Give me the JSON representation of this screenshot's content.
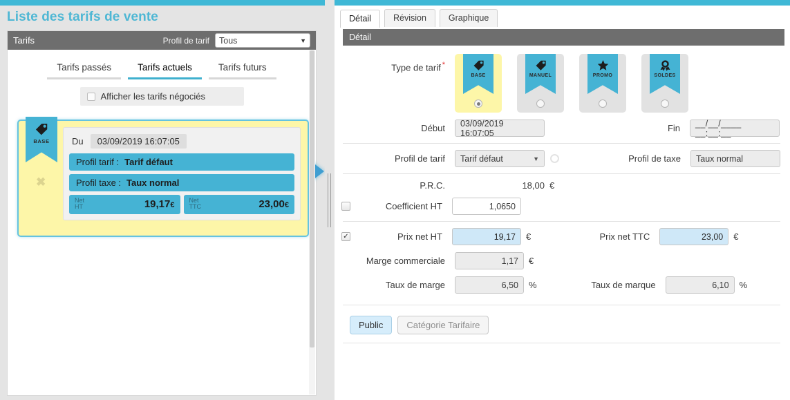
{
  "page": {
    "title": "Liste des tarifs de vente"
  },
  "left": {
    "bar": {
      "title": "Tarifs",
      "profile_label": "Profil de tarif",
      "profile_value": "Tous"
    },
    "tabs": [
      {
        "label": "Tarifs passés",
        "active": false
      },
      {
        "label": "Tarifs actuels",
        "active": true
      },
      {
        "label": "Tarifs futurs",
        "active": false
      }
    ],
    "negotiated": {
      "label": "Afficher les tarifs négociés",
      "checked": false
    },
    "card": {
      "ribbon_label": "BASE",
      "close_label": "✖",
      "du_label": "Du",
      "du_value": "03/09/2019 16:07:05",
      "profil_tarif_label": "Profil tarif :",
      "profil_tarif_value": "Tarif défaut",
      "profil_taxe_label": "Profil taxe :",
      "profil_taxe_value": "Taux normal",
      "net_ht_label_1": "Net",
      "net_ht_label_2": "HT",
      "net_ht_value": "19,17",
      "net_ht_currency": "€",
      "net_ttc_label_1": "Net",
      "net_ttc_label_2": "TTC",
      "net_ttc_value": "23,00",
      "net_ttc_currency": "€"
    }
  },
  "right": {
    "tabs": [
      {
        "label": "Détail",
        "active": true
      },
      {
        "label": "Révision",
        "active": false
      },
      {
        "label": "Graphique",
        "active": false
      }
    ],
    "section_title": "Détail",
    "type_de_tarif": {
      "label": "Type de tarif",
      "required_marker": "*",
      "options": [
        {
          "label": "BASE",
          "icon": "price-tag-icon",
          "selected": true
        },
        {
          "label": "MANUEL",
          "icon": "price-tag-icon",
          "selected": false
        },
        {
          "label": "PROMO",
          "icon": "star-icon",
          "selected": false
        },
        {
          "label": "SOLDES",
          "icon": "rosette-icon",
          "selected": false
        }
      ]
    },
    "fields": {
      "debut_label": "Début",
      "debut_value": "03/09/2019 16:07:05",
      "fin_label": "Fin",
      "fin_value": "__/__/____ __:__:__",
      "profil_tarif_label": "Profil de tarif",
      "profil_tarif_value": "Tarif défaut",
      "profil_taxe_label": "Profil de taxe",
      "profil_taxe_value": "Taux normal",
      "prc_label": "P.R.C.",
      "prc_value": "18,00",
      "prc_unit": "€",
      "coefficient_ht_label": "Coefficient HT",
      "coefficient_ht_value": "1,0650",
      "coefficient_ht_checked": false,
      "prix_net_ht_label": "Prix net HT",
      "prix_net_ht_value": "19,17",
      "prix_net_ht_unit": "€",
      "prix_net_ht_checked": true,
      "prix_net_ttc_label": "Prix net TTC",
      "prix_net_ttc_value": "23,00",
      "prix_net_ttc_unit": "€",
      "marge_commerciale_label": "Marge commerciale",
      "marge_commerciale_value": "1,17",
      "marge_commerciale_unit": "€",
      "taux_de_marge_label": "Taux de marge",
      "taux_de_marge_value": "6,50",
      "taux_de_marge_unit": "%",
      "taux_de_marque_label": "Taux de marque",
      "taux_de_marque_value": "6,10",
      "taux_de_marque_unit": "%"
    },
    "buttons": [
      {
        "label": "Public",
        "active": true
      },
      {
        "label": "Catégorie Tarifaire",
        "active": false
      }
    ]
  },
  "colors": {
    "accent": "#3fb8d6",
    "ribbon": "#45b3d4",
    "highlight": "#fdf6a8",
    "bar": "#6e6e6e",
    "input_blue": "#cfe8f8"
  }
}
